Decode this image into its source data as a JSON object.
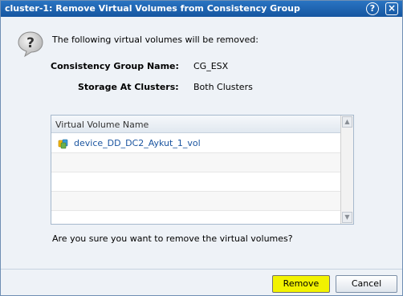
{
  "dialog": {
    "title": "cluster-1: Remove Virtual Volumes from Consistency Group",
    "help_label": "?",
    "close_label": "×",
    "icon": "question-icon",
    "heading": "The following virtual volumes will be removed:",
    "fields": [
      {
        "label": "Consistency Group Name:",
        "value": "CG_ESX"
      },
      {
        "label": "Storage At Clusters:",
        "value": "Both Clusters"
      }
    ],
    "table": {
      "column_header": "Virtual Volume Name",
      "rows": [
        {
          "icon": "virtual-volume-icon",
          "name": "device_DD_DC2_Aykut_1_vol"
        }
      ]
    },
    "confirm_text": "Are you sure you want to remove the virtual volumes?",
    "buttons": {
      "remove": "Remove",
      "cancel": "Cancel"
    },
    "colors": {
      "title_bar": "#1b5fa3",
      "remove_highlight": "#f2f200",
      "link_blue": "#1b55a0"
    }
  }
}
